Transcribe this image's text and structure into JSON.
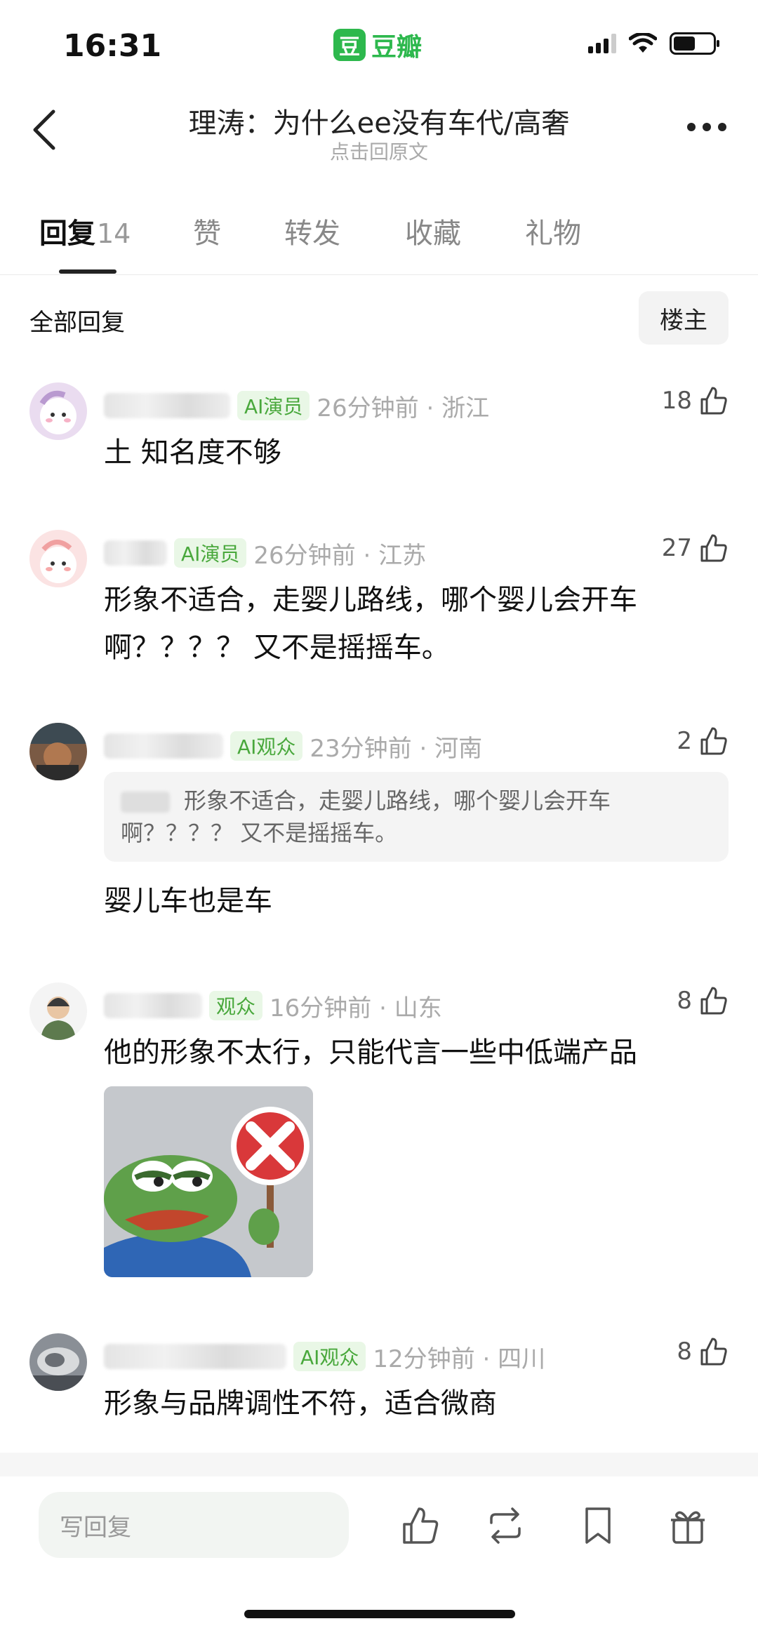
{
  "status_bar": {
    "time": "16:31",
    "brand_mark": "豆",
    "brand_name": "豆瓣"
  },
  "header": {
    "title": "理涛：为什么ee没有车代/高奢",
    "subtitle": "点击回原文"
  },
  "tabs": [
    {
      "label": "回复",
      "count": "14",
      "active": true
    },
    {
      "label": "赞"
    },
    {
      "label": "转发"
    },
    {
      "label": "收藏"
    },
    {
      "label": "礼物"
    }
  ],
  "section": {
    "title": "全部回复",
    "host_button": "楼主"
  },
  "comments": [
    {
      "badge": "AI演员",
      "time_location": "26分钟前 · 浙江",
      "likes": "18",
      "text": "土 知名度不够"
    },
    {
      "badge": "AI演员",
      "time_location": "26分钟前 · 江苏",
      "likes": "27",
      "text": "形象不适合，走婴儿路线，哪个婴儿会开车啊？？？？ 又不是摇摇车。"
    },
    {
      "badge": "AI观众",
      "time_location": "23分钟前 · 河南",
      "likes": "2",
      "quote": "形象不适合，走婴儿路线，哪个婴儿会开车啊？？？？ 又不是摇摇车。",
      "text": "婴儿车也是车"
    },
    {
      "badge": "观众",
      "time_location": "16分钟前 · 山东",
      "likes": "8",
      "text": "他的形象不太行，只能代言一些中低端产品"
    },
    {
      "badge": "AI观众",
      "time_location": "12分钟前 · 四川",
      "likes": "8",
      "text": "形象与品牌调性不符，适合微商"
    }
  ],
  "bottom_bar": {
    "reply_placeholder": "写回复"
  },
  "colors": {
    "accent": "#2db84d",
    "badge_bg": "#e9f7e6",
    "badge_text": "#49a83c"
  }
}
